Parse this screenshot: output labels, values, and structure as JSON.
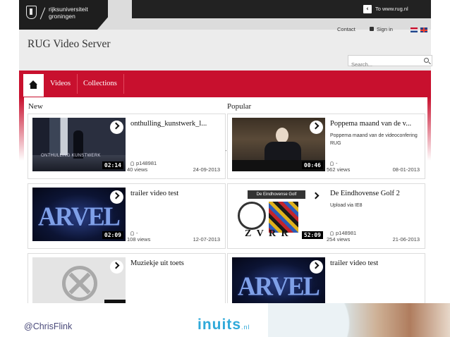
{
  "header": {
    "university_line1": "rijksuniversiteit",
    "university_line2": "groningen",
    "back_link": "To www.rug.nl",
    "contact": "Contact",
    "signin": "Sign in",
    "site_title": "RUG Video Server",
    "search_placeholder": "Search..."
  },
  "nav": {
    "videos": "Videos",
    "collections": "Collections"
  },
  "sections": {
    "new": "New",
    "popular": "Popular"
  },
  "new_videos": [
    {
      "title": "onthulling_kunstwerk_l...",
      "description": "",
      "user": "p148981",
      "views": "40 views",
      "date": "24-09-2013",
      "duration": "02:14"
    },
    {
      "title": "trailer video test",
      "description": "",
      "user": "-",
      "views": "108 views",
      "date": "12-07-2013",
      "duration": "02:09"
    },
    {
      "title": "Muziekje uit toets",
      "description": "",
      "user": "",
      "views": "",
      "date": "",
      "duration": ""
    }
  ],
  "popular_videos": [
    {
      "title": "Poppema maand van de v...",
      "description": "Poppema maand van de videoconfering RUG",
      "user": "-",
      "views": "562 views",
      "date": "08-01-2013",
      "duration": "00:46"
    },
    {
      "title": "De Eindhovense Golf 2",
      "description": "Upload via IE8",
      "user": "p148981",
      "views": "254 views",
      "date": "21-06-2013",
      "duration": "52:09"
    },
    {
      "title": "trailer video test",
      "description": "",
      "user": "",
      "views": "",
      "date": "",
      "duration": ""
    }
  ],
  "thumb_text": {
    "museum": "ONTHULLING KUNSTWERK",
    "marvel": "ARVEL",
    "eindhoven_banner": "De Eindhovense Golf",
    "eindhoven_bottom": "Z V R R"
  },
  "stray_char": "v",
  "footer": {
    "handle": "@ChrisFlink",
    "brand": "inuits",
    "brand_suffix": ".nl"
  },
  "colors": {
    "accent_red": "#c8102e",
    "topbar_dark": "#1e1e1e",
    "brand_blue": "#2fa9d9"
  }
}
